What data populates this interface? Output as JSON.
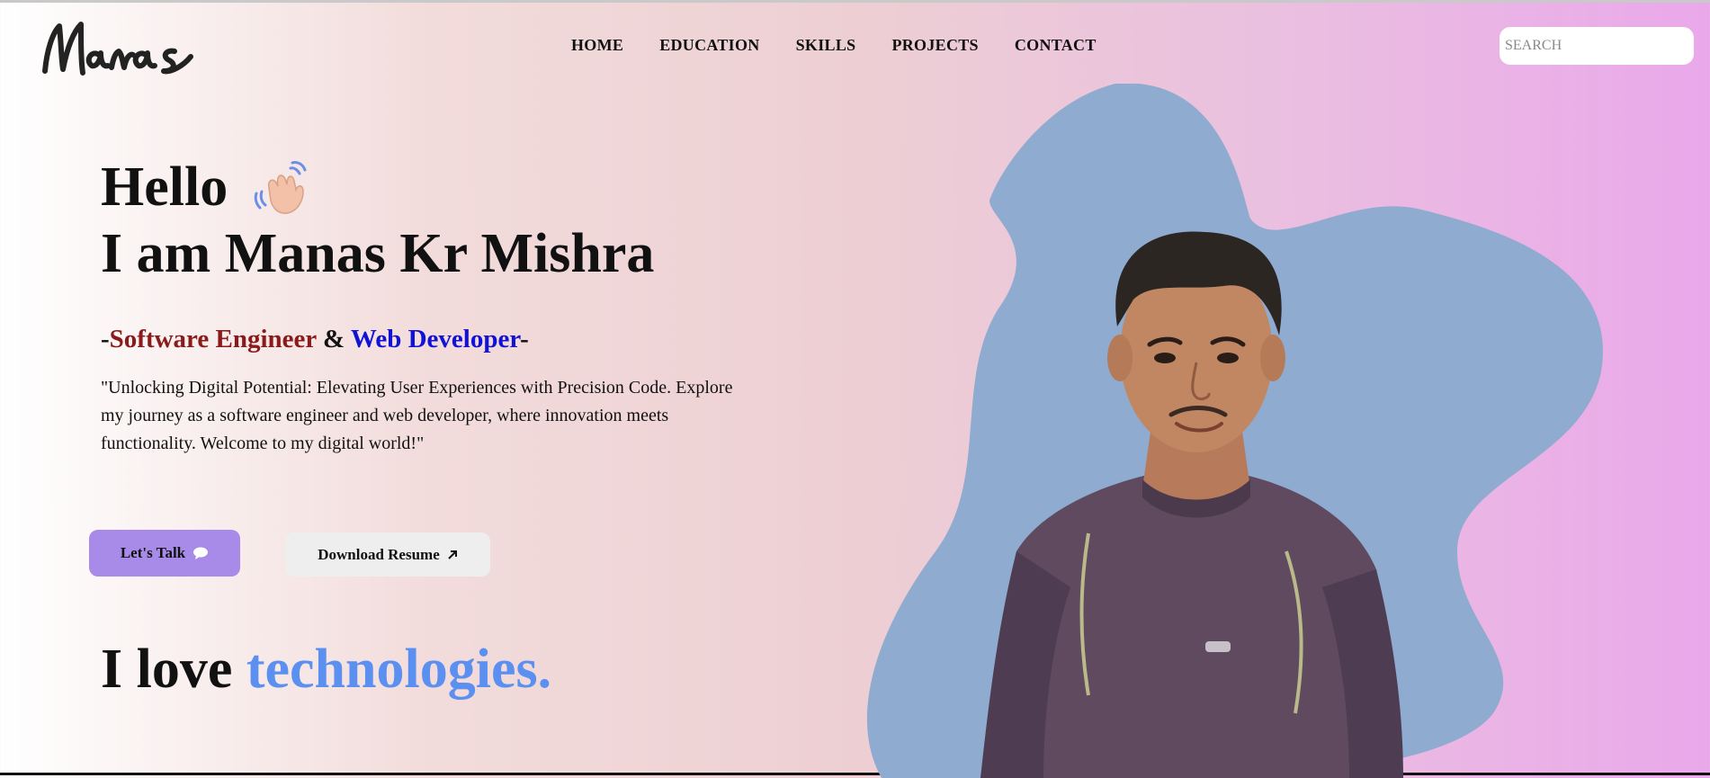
{
  "logo": {
    "text": "Manas"
  },
  "nav": {
    "items": [
      "HOME",
      "EDUCATION",
      "SKILLS",
      "PROJECTS",
      "CONTACT"
    ]
  },
  "search": {
    "placeholder": "SEARCH"
  },
  "hero": {
    "greeting": "Hello",
    "wave_icon": "waving-hand-icon",
    "name_line": "I am Manas Kr Mishra",
    "roles": {
      "prefix": "-",
      "role1": "Software Engineer",
      "joiner": " & ",
      "role2": "Web Developer",
      "suffix": "-"
    },
    "intro": "\"Unlocking Digital Potential: Elevating User Experiences with Precision Code. Explore my journey as a software engineer and web developer, where innovation meets functionality. Welcome to my digital world!\""
  },
  "buttons": {
    "talk_label": "Let's Talk",
    "talk_icon": "chat-bubble-icon",
    "resume_label": "Download Resume",
    "resume_icon": "arrow-up-right-icon"
  },
  "tagline": {
    "lead": "I love ",
    "highlight": "technologies."
  },
  "colors": {
    "accent_purple": "#a88be8",
    "role1": "#8b1a1a",
    "role2": "#1212d6",
    "tech_blue": "#5b8ff0",
    "blob": "#8fabcf"
  }
}
